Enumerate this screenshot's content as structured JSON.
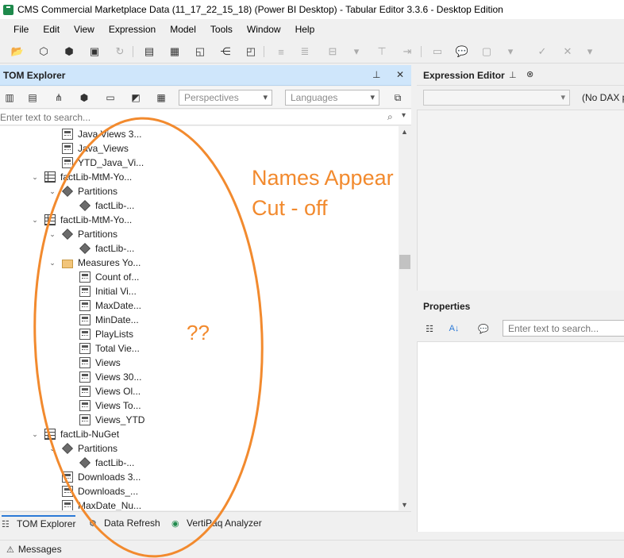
{
  "window": {
    "title": "CMS Commercial Marketplace Data (11_17_22_15_18) (Power BI Desktop) - Tabular Editor 3.3.6 - Desktop Edition"
  },
  "menu": [
    "File",
    "Edit",
    "View",
    "Expression",
    "Model",
    "Tools",
    "Window",
    "Help"
  ],
  "tom": {
    "title": "TOM Explorer",
    "perspectives": "Perspectives",
    "languages": "Languages",
    "search_placeholder": "Enter text to search...",
    "rows": [
      {
        "label": "Java Views 3...",
        "kind": "measure",
        "indent": 1
      },
      {
        "label": "Java_Views",
        "kind": "measure",
        "indent": 1
      },
      {
        "label": "YTD_Java_Vi...",
        "kind": "measure",
        "indent": 1
      },
      {
        "label": "factLib-MtM-Yo...",
        "kind": "table",
        "indent": 0,
        "exp": "⌄"
      },
      {
        "label": "Partitions",
        "kind": "part",
        "indent": 1,
        "exp": "⌄"
      },
      {
        "label": "factLib-...",
        "kind": "part",
        "indent": 2
      },
      {
        "label": "factLib-MtM-Yo...",
        "kind": "table",
        "indent": 0,
        "exp": "⌄"
      },
      {
        "label": "Partitions",
        "kind": "part",
        "indent": 1,
        "exp": "⌄"
      },
      {
        "label": "factLib-...",
        "kind": "part",
        "indent": 2
      },
      {
        "label": "Measures Yo...",
        "kind": "folder",
        "indent": 1,
        "exp": "⌄"
      },
      {
        "label": "Count of...",
        "kind": "measure",
        "indent": 2
      },
      {
        "label": "Initial Vi...",
        "kind": "measure",
        "indent": 2
      },
      {
        "label": "MaxDate...",
        "kind": "measure",
        "indent": 2
      },
      {
        "label": "MinDate...",
        "kind": "measure",
        "indent": 2
      },
      {
        "label": "PlayLists",
        "kind": "measure",
        "indent": 2
      },
      {
        "label": "Total Vie...",
        "kind": "measure",
        "indent": 2
      },
      {
        "label": "Views",
        "kind": "measure",
        "indent": 2
      },
      {
        "label": "Views 30...",
        "kind": "measure",
        "indent": 2
      },
      {
        "label": "Views Ol...",
        "kind": "measure",
        "indent": 2
      },
      {
        "label": "Views To...",
        "kind": "measure",
        "indent": 2
      },
      {
        "label": "Views_YTD",
        "kind": "measure",
        "indent": 2
      },
      {
        "label": "factLib-NuGet",
        "kind": "table",
        "indent": 0,
        "exp": "⌄"
      },
      {
        "label": "Partitions",
        "kind": "part",
        "indent": 1,
        "exp": "⌄"
      },
      {
        "label": "factLib-...",
        "kind": "part",
        "indent": 2
      },
      {
        "label": "Downloads 3...",
        "kind": "measure",
        "indent": 1
      },
      {
        "label": "Downloads_...",
        "kind": "measure",
        "indent": 1
      },
      {
        "label": "MaxDate_Nu...",
        "kind": "measure",
        "indent": 1
      }
    ]
  },
  "bottom_tabs": [
    "TOM Explorer",
    "Data Refresh",
    "VertiPaq Analyzer"
  ],
  "expression_editor": {
    "title": "Expression Editor",
    "nodax": "(No DAX p"
  },
  "properties": {
    "title": "Properties",
    "search_placeholder": "Enter text to search..."
  },
  "status": {
    "messages": "Messages"
  },
  "annotation": {
    "line1": "Names Appear",
    "line2": "Cut - off",
    "question": "??"
  },
  "colors": {
    "accent": "#f28a2e",
    "header": "#cfe6fb"
  }
}
